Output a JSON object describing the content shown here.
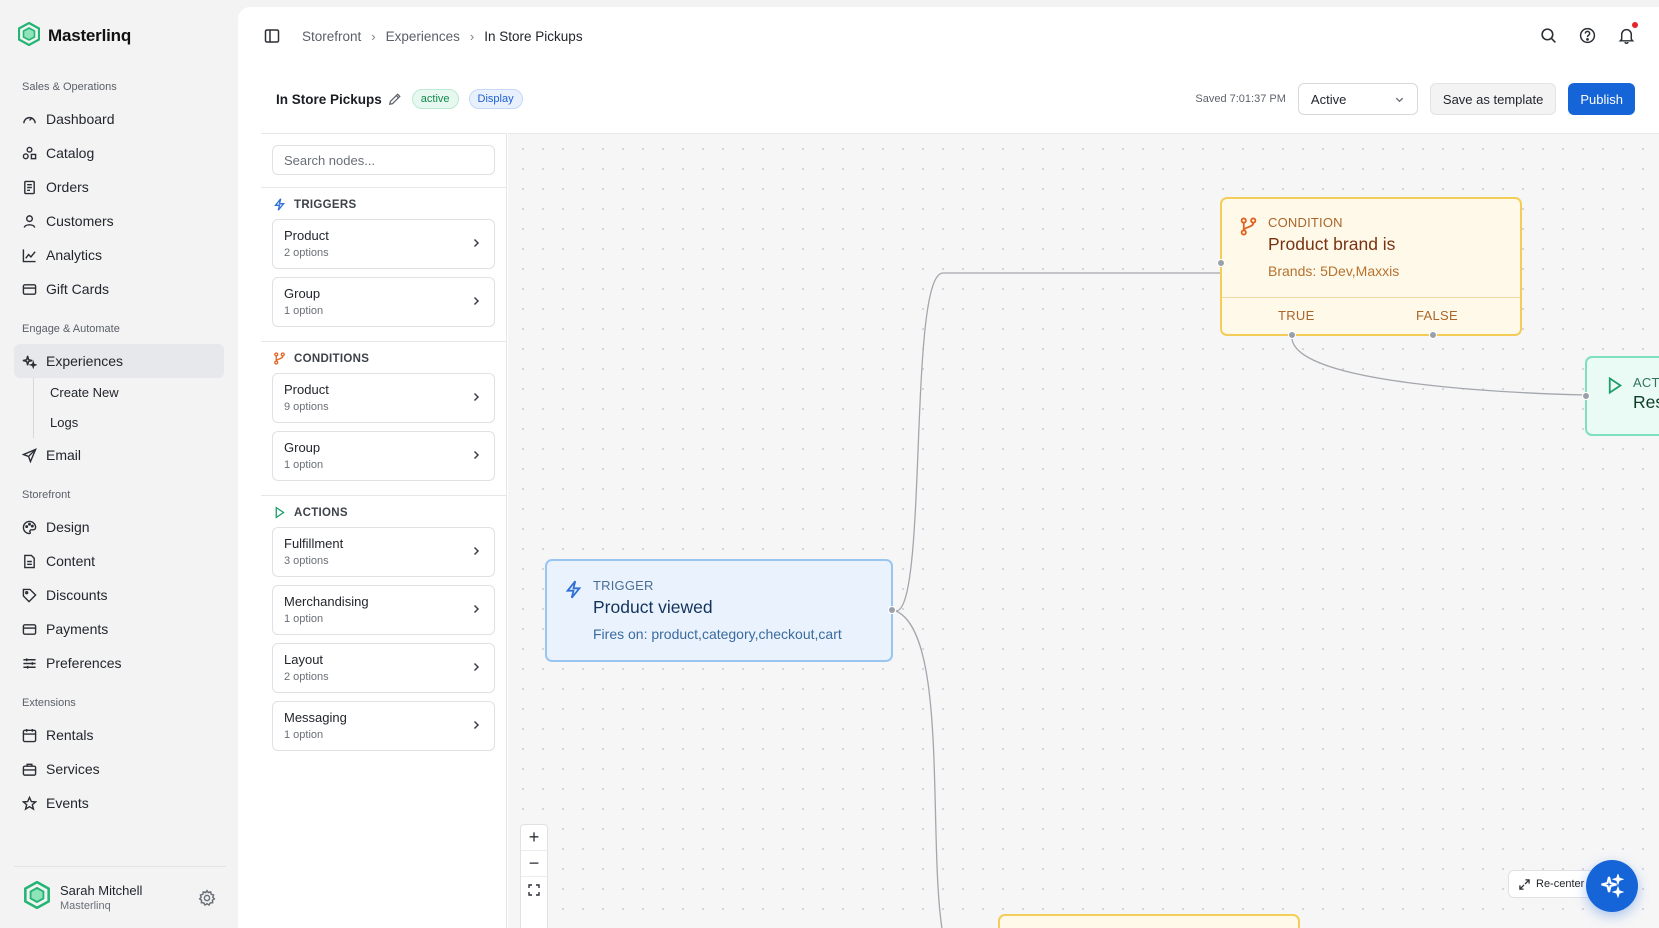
{
  "brand": {
    "name": "Masterlinq"
  },
  "sidebar": {
    "sections": [
      {
        "label": "Sales & Operations",
        "items": [
          "Dashboard",
          "Catalog",
          "Orders",
          "Customers",
          "Analytics",
          "Gift Cards"
        ]
      },
      {
        "label": "Engage & Automate",
        "items": [
          "Experiences",
          "Email"
        ],
        "sub_items": [
          "Create New",
          "Logs"
        ]
      },
      {
        "label": "Storefront",
        "items": [
          "Design",
          "Content",
          "Discounts",
          "Payments",
          "Preferences"
        ]
      },
      {
        "label": "Extensions",
        "items": [
          "Rentals",
          "Services",
          "Events"
        ]
      }
    ],
    "active_item": "Experiences"
  },
  "user": {
    "name": "Sarah Mitchell",
    "org": "Masterlinq"
  },
  "breadcrumb": [
    "Storefront",
    "Experiences",
    "In Store Pickups"
  ],
  "experience": {
    "title": "In Store Pickups",
    "status_badge": "active",
    "type_badge": "Display",
    "saved_text": "Saved 7:01:37 PM",
    "status_select": "Active",
    "save_template_label": "Save as template",
    "publish_label": "Publish"
  },
  "palette": {
    "search_placeholder": "Search nodes...",
    "triggers_label": "TRIGGERS",
    "triggers": [
      {
        "title": "Product",
        "sub": "2 options"
      },
      {
        "title": "Group",
        "sub": "1 option"
      }
    ],
    "conditions_label": "CONDITIONS",
    "conditions": [
      {
        "title": "Product",
        "sub": "9 options"
      },
      {
        "title": "Group",
        "sub": "1 option"
      }
    ],
    "actions_label": "ACTIONS",
    "actions": [
      {
        "title": "Fulfillment",
        "sub": "3 options"
      },
      {
        "title": "Merchandising",
        "sub": "1 option"
      },
      {
        "title": "Layout",
        "sub": "2 options"
      },
      {
        "title": "Messaging",
        "sub": "1 option"
      }
    ]
  },
  "canvas": {
    "condition_node": {
      "label": "CONDITION",
      "title": "Product brand is",
      "sub": "Brands: 5Dev,Maxxis",
      "true_label": "TRUE",
      "false_label": "FALSE"
    },
    "action_node": {
      "label": "ACTION",
      "title": "Restrict to pickup only"
    },
    "trigger_node": {
      "label": "TRIGGER",
      "title": "Product viewed",
      "sub": "Fires on: product,category,checkout,cart"
    },
    "zoom_in": "+",
    "zoom_out": "−",
    "recenter_label": "Re-center"
  },
  "colors": {
    "accent": "#1665d8",
    "condition": "#f4cd59",
    "action": "#7ee0bd",
    "trigger": "#99c6f0",
    "brand": "#22b573"
  }
}
